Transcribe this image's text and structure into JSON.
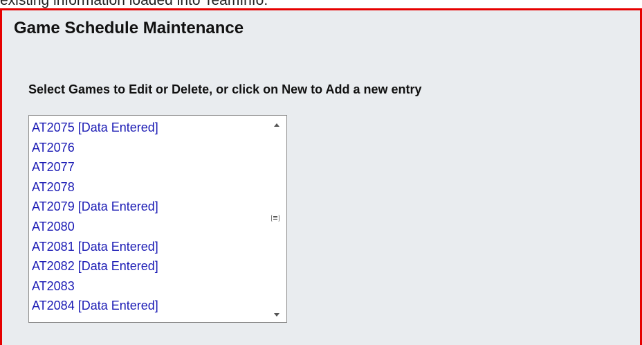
{
  "top_caption": "existing information loaded into TeamInfo.",
  "page": {
    "title": "Game Schedule Maintenance",
    "instruction": "Select Games to Edit or Delete, or click on New to Add a new entry"
  },
  "games_list": {
    "items": [
      "AT2075 [Data Entered]",
      "AT2076",
      "AT2077",
      "AT2078",
      "AT2079 [Data Entered]",
      "AT2080",
      "AT2081 [Data Entered]",
      "AT2082 [Data Entered]",
      "AT2083",
      "AT2084 [Data Entered]"
    ]
  },
  "colors": {
    "frame_border": "#e60000",
    "panel_bg": "#e9ecef",
    "list_text": "#1a1ab4"
  }
}
